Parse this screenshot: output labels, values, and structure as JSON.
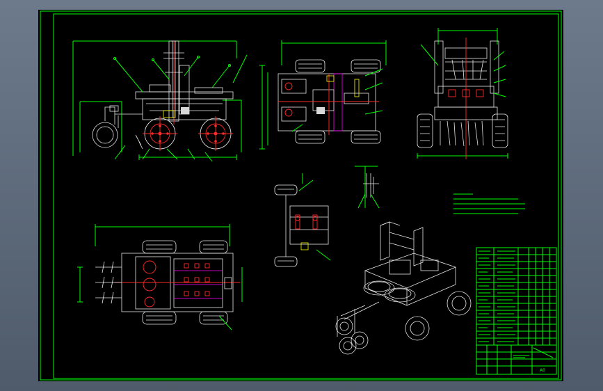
{
  "sheet": {
    "border_color": "#00ff00",
    "background": "#000000",
    "viewport_background": "#5b6878"
  },
  "colors": {
    "outline": "#e8e8e8",
    "centerline": "#ff2a2a",
    "dimension": "#00ff00",
    "hatch": "#ff00ff",
    "highlight": "#ffff00"
  },
  "views": [
    {
      "key": "side-elevation",
      "icon": "side-view-drawing"
    },
    {
      "key": "top-plan",
      "icon": "top-view-drawing"
    },
    {
      "key": "front-elevation",
      "icon": "front-view-drawing"
    },
    {
      "key": "bottom-plan",
      "icon": "bottom-view-drawing"
    },
    {
      "key": "wheel-detail",
      "icon": "wheel-detail-drawing"
    },
    {
      "key": "blade-detail",
      "icon": "blade-detail-drawing"
    },
    {
      "key": "isometric",
      "icon": "isometric-view-drawing"
    }
  ],
  "title_block": {
    "scale_text": "A0"
  }
}
